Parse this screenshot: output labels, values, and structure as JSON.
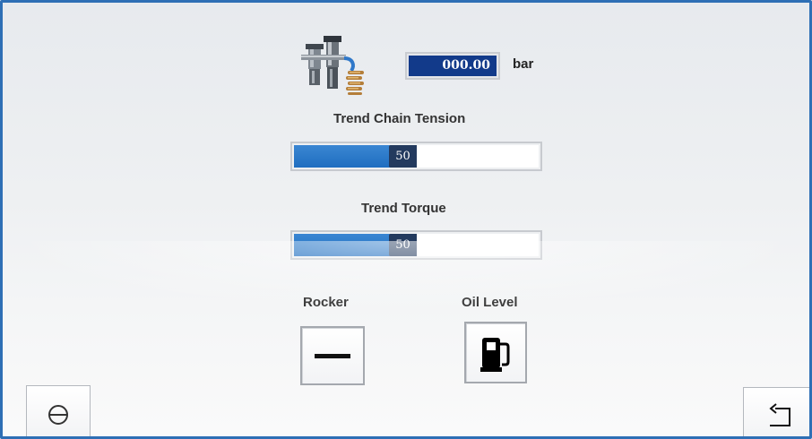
{
  "pressure": {
    "value": "000.00",
    "unit": "bar"
  },
  "trends": [
    {
      "label": "Trend Chain Tension",
      "value": "50",
      "fill_fraction": 0.5
    },
    {
      "label": "Trend Torque",
      "value": "50",
      "fill_fraction": 0.5
    }
  ],
  "status": {
    "rocker_label": "Rocker",
    "oil_level_label": "Oil Level"
  },
  "icons": {
    "filter_unit": "pneumatic-filter-regulator-icon",
    "rocker": "dash-icon",
    "oil_level": "fuel-pump-icon",
    "left_button": "circle-minus-icon",
    "right_button": "return-arrow-icon"
  },
  "colors": {
    "frame_border": "#2e6fb5",
    "value_display": "#123a8a",
    "bar_fill": "#1f6ec0",
    "bar_marker": "#233a5e"
  }
}
